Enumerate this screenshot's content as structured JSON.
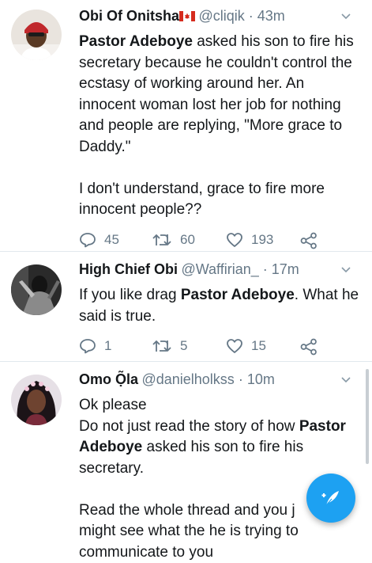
{
  "tweets": [
    {
      "name": "Obi Of Onitsha",
      "flag": "canada-flag",
      "handle": "@cliqik",
      "time": "43m",
      "paragraphs": [
        [
          {
            "t": "Pastor Adeboye",
            "b": true
          },
          {
            "t": " asked his son to fire his secretary because he couldn't control the ecstasy of working around her. An innocent woman lost her job for nothing and people are replying, \"More grace to Daddy.\"",
            "b": false
          }
        ],
        [
          {
            "t": "I don't understand, grace to fire more innocent people??",
            "b": false
          }
        ]
      ],
      "replies": "45",
      "retweets": "60",
      "likes": "193"
    },
    {
      "name": "High Chief Obi",
      "handle": "@Waffirian_",
      "time": "17m",
      "paragraphs": [
        [
          {
            "t": "If you like drag ",
            "b": false
          },
          {
            "t": "Pastor Adeboye",
            "b": true
          },
          {
            "t": ". What he said is true.",
            "b": false
          }
        ]
      ],
      "replies": "1",
      "retweets": "5",
      "likes": "15"
    },
    {
      "name": "Omo Ọ̃la",
      "handle": "@danielholkss",
      "time": "10m",
      "paragraphs": [
        [
          {
            "t": "Ok please",
            "b": false
          }
        ],
        [
          {
            "t": "Do not just read the story of how ",
            "b": false
          },
          {
            "t": "Pastor Adeboye",
            "b": true
          },
          {
            "t": " asked his son to fire his secretary.",
            "b": false
          }
        ],
        [
          {
            "t": "Read the whole thread and you j",
            "b": false
          }
        ],
        [
          {
            "t": "might see what the he is trying to",
            "b": false
          }
        ],
        [
          {
            "t": "communicate to you",
            "b": false
          }
        ]
      ]
    }
  ],
  "icons": {
    "reply": "reply-icon",
    "retweet": "retweet-icon",
    "like": "heart-icon",
    "share": "share-icon",
    "caret": "chevron-down-icon",
    "compose": "compose-tweet-icon"
  },
  "colors": {
    "accent": "#1da1f2",
    "secondary_text": "#657786",
    "divider": "#e1e8ed"
  }
}
